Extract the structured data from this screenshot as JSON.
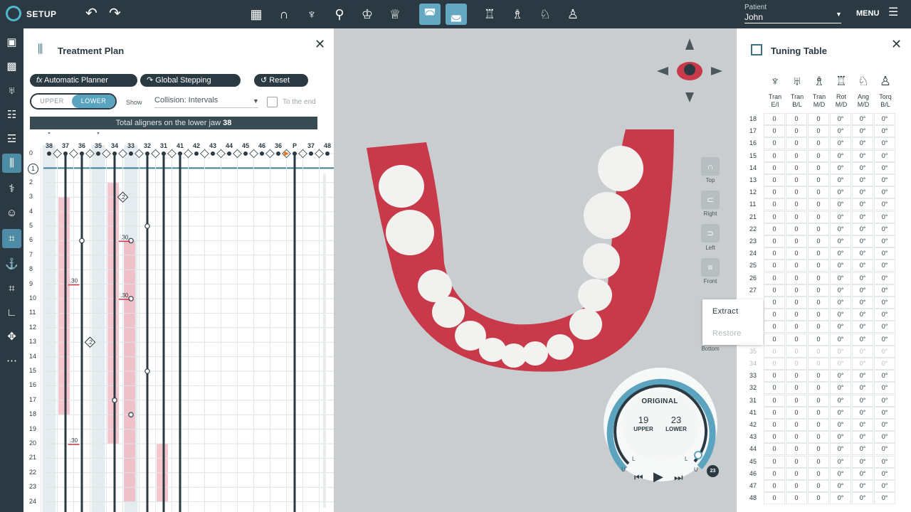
{
  "topbar": {
    "app_label": "SETUP",
    "patient_label": "Patient",
    "patient_name": "John",
    "menu_label": "MENU"
  },
  "plan": {
    "title": "Treatment Plan",
    "automatic_planner": "Automatic Planner",
    "global_stepping": "Global Stepping",
    "reset": "Reset",
    "upper": "UPPER",
    "lower": "LOWER",
    "show_label": "Show",
    "collision_value": "Collision: Intervals",
    "to_end": "To the end",
    "total_text": "Total aligners on the lower jaw",
    "total_value": "38",
    "teeth": [
      "38",
      "37",
      "36",
      "35",
      "34",
      "33",
      "32",
      "31",
      "41",
      "42",
      "43",
      "44",
      "45",
      "46",
      "36",
      "P",
      "37",
      "48"
    ],
    "rows": [
      "0",
      "1",
      "2",
      "3",
      "4",
      "5",
      "6",
      "7",
      "8",
      "9",
      "10",
      "11",
      "12",
      "13",
      "14",
      "15",
      "16",
      "17",
      "18",
      "19",
      "20",
      "21",
      "22",
      "23",
      "24"
    ],
    "ipr": [
      ".2",
      ".30",
      ".30",
      ".30",
      ".2",
      ".30"
    ]
  },
  "tuning": {
    "title": "Tuning Table",
    "columns": [
      {
        "top": "Tran",
        "bottom": "E/I"
      },
      {
        "top": "Tran",
        "bottom": "B/L"
      },
      {
        "top": "Tran",
        "bottom": "M/D"
      },
      {
        "top": "Rot",
        "bottom": "M/D"
      },
      {
        "top": "Ang",
        "bottom": "M/D"
      },
      {
        "top": "Torq",
        "bottom": "B/L"
      }
    ],
    "rows": [
      {
        "id": "18",
        "vals": [
          "0",
          "0",
          "0",
          "0°",
          "0°",
          "0°"
        ]
      },
      {
        "id": "17",
        "vals": [
          "0",
          "0",
          "0",
          "0°",
          "0°",
          "0°"
        ]
      },
      {
        "id": "16",
        "vals": [
          "0",
          "0",
          "0",
          "0°",
          "0°",
          "0°"
        ]
      },
      {
        "id": "15",
        "vals": [
          "0",
          "0",
          "0",
          "0°",
          "0°",
          "0°"
        ]
      },
      {
        "id": "14",
        "vals": [
          "0",
          "0",
          "0",
          "0°",
          "0°",
          "0°"
        ]
      },
      {
        "id": "13",
        "vals": [
          "0",
          "0",
          "0",
          "0°",
          "0°",
          "0°"
        ]
      },
      {
        "id": "12",
        "vals": [
          "0",
          "0",
          "0",
          "0°",
          "0°",
          "0°"
        ]
      },
      {
        "id": "11",
        "vals": [
          "0",
          "0",
          "0",
          "0°",
          "0°",
          "0°"
        ]
      },
      {
        "id": "21",
        "vals": [
          "0",
          "0",
          "0",
          "0°",
          "0°",
          "0°"
        ]
      },
      {
        "id": "22",
        "vals": [
          "0",
          "0",
          "0",
          "0°",
          "0°",
          "0°"
        ]
      },
      {
        "id": "23",
        "vals": [
          "0",
          "0",
          "0",
          "0°",
          "0°",
          "0°"
        ]
      },
      {
        "id": "24",
        "vals": [
          "0",
          "0",
          "0",
          "0°",
          "0°",
          "0°"
        ]
      },
      {
        "id": "25",
        "vals": [
          "0",
          "0",
          "0",
          "0°",
          "0°",
          "0°"
        ]
      },
      {
        "id": "26",
        "vals": [
          "0",
          "0",
          "0",
          "0°",
          "0°",
          "0°"
        ]
      },
      {
        "id": "27",
        "vals": [
          "0",
          "0",
          "0",
          "0°",
          "0°",
          "0°"
        ]
      },
      {
        "id": "",
        "vals": [
          "0",
          "0",
          "0",
          "0°",
          "0°",
          "0°"
        ]
      },
      {
        "id": "",
        "vals": [
          "0",
          "0",
          "0",
          "0°",
          "0°",
          "0°"
        ]
      },
      {
        "id": "",
        "vals": [
          "0",
          "0",
          "0",
          "0°",
          "0°",
          "0°"
        ]
      },
      {
        "id": "",
        "vals": [
          "0",
          "0",
          "0",
          "0°",
          "0°",
          "0°"
        ]
      },
      {
        "id": "35",
        "vals": [
          "0",
          "0",
          "0",
          "0°",
          "0°",
          "0°"
        ]
      },
      {
        "id": "34",
        "vals": [
          "0",
          "0",
          "0",
          "0°",
          "0°",
          "0°"
        ]
      },
      {
        "id": "33",
        "vals": [
          "0",
          "0",
          "0",
          "0°",
          "0°",
          "0°"
        ]
      },
      {
        "id": "32",
        "vals": [
          "0",
          "0",
          "0",
          "0°",
          "0°",
          "0°"
        ]
      },
      {
        "id": "31",
        "vals": [
          "0",
          "0",
          "0",
          "0°",
          "0°",
          "0°"
        ]
      },
      {
        "id": "41",
        "vals": [
          "0",
          "0",
          "0",
          "0°",
          "0°",
          "0°"
        ]
      },
      {
        "id": "42",
        "vals": [
          "0",
          "0",
          "0",
          "0°",
          "0°",
          "0°"
        ]
      },
      {
        "id": "43",
        "vals": [
          "0",
          "0",
          "0",
          "0°",
          "0°",
          "0°"
        ]
      },
      {
        "id": "44",
        "vals": [
          "0",
          "0",
          "0",
          "0°",
          "0°",
          "0°"
        ]
      },
      {
        "id": "45",
        "vals": [
          "0",
          "0",
          "0",
          "0°",
          "0°",
          "0°"
        ]
      },
      {
        "id": "46",
        "vals": [
          "0",
          "0",
          "0",
          "0°",
          "0°",
          "0°"
        ]
      },
      {
        "id": "47",
        "vals": [
          "0",
          "0",
          "0",
          "0°",
          "0°",
          "0°"
        ]
      },
      {
        "id": "48",
        "vals": [
          "0",
          "0",
          "0",
          "0°",
          "0°",
          "0°"
        ]
      }
    ]
  },
  "context_menu": {
    "extract": "Extract",
    "restore": "Restore"
  },
  "views": {
    "top": "Top",
    "right": "Right",
    "left": "Left",
    "front": "Front",
    "bottom": "Bottom"
  },
  "dial": {
    "title": "ORIGINAL",
    "upper_value": "19",
    "upper_label": "UPPER",
    "lower_value": "23",
    "lower_label": "LOWER",
    "badge": "23",
    "marks": [
      "U",
      "L",
      "L",
      "U"
    ]
  },
  "colors": {
    "dark": "#2b3a42",
    "accent": "#5ba4c0",
    "gum": "#c8394a"
  }
}
